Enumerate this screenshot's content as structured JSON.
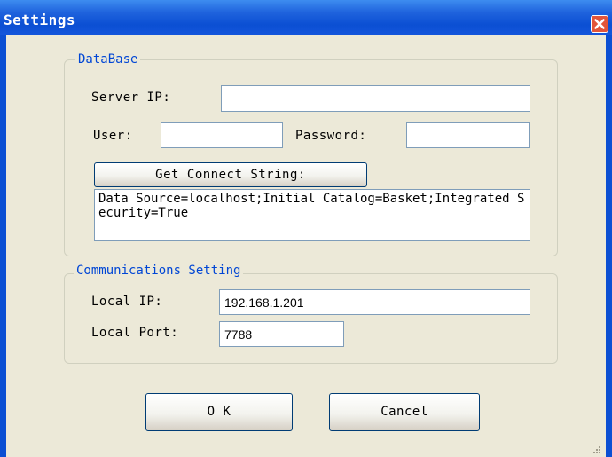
{
  "window": {
    "title": "Settings"
  },
  "database": {
    "group_title": "DataBase",
    "server_ip_label": "Server IP:",
    "server_ip_value": "",
    "user_label": "User:",
    "user_value": "",
    "password_label": "Password:",
    "password_value": "",
    "get_connect_button": "Get Connect String:",
    "connection_string": "Data Source=localhost;Initial Catalog=Basket;Integrated Security=True"
  },
  "communications": {
    "group_title": "Communications Setting",
    "local_ip_label": "Local IP:",
    "local_ip_value": "192.168.1.201",
    "local_port_label": "Local Port:",
    "local_port_value": "7788"
  },
  "buttons": {
    "ok": "O K",
    "cancel": "Cancel"
  },
  "colors": {
    "title_bar": "#0b4fd3",
    "dialog_bg": "#ece9d8",
    "group_title": "#0046d5",
    "close": "#e2553a"
  }
}
